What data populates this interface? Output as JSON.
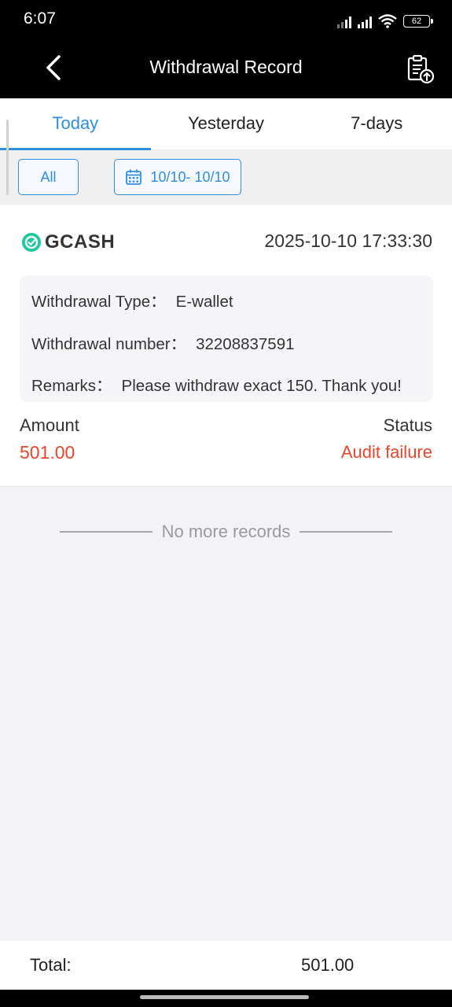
{
  "status_bar": {
    "time": "6:07",
    "battery": "62"
  },
  "header": {
    "title": "Withdrawal Record",
    "back_icon": "chevron-left-icon",
    "export_icon": "clipboard-upload-icon"
  },
  "tabs": [
    {
      "label": "Today",
      "active": true
    },
    {
      "label": "Yesterday",
      "active": false
    },
    {
      "label": "7-days",
      "active": false
    }
  ],
  "filters": {
    "type_label": "All",
    "date_range": "10/10- 10/10"
  },
  "records": [
    {
      "provider": "GCASH",
      "datetime": "2025-10-10 17:33:30",
      "type_label": "Withdrawal Type：",
      "type_value": "E-wallet",
      "number_label": "Withdrawal number：",
      "number_value": "32208837591",
      "remarks_label": "Remarks：",
      "remarks_value": "Please withdraw exact 150. Thank you!",
      "amount_label": "Amount",
      "amount_value": "501.00",
      "status_label": "Status",
      "status_value": "Audit failure"
    }
  ],
  "list_end_text": "No more records",
  "footer": {
    "total_label": "Total:",
    "total_value": "501.00"
  },
  "colors": {
    "accent": "#2e8ee0",
    "error": "#e5462e",
    "gcash": "#1fc7a0"
  }
}
